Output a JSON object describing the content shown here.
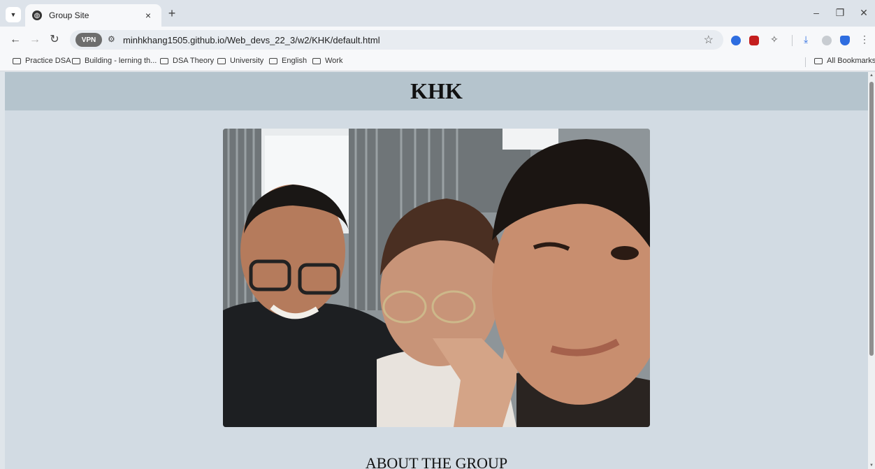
{
  "browser": {
    "tab": {
      "title": "Group Site",
      "close_icon": "×"
    },
    "new_tab_label": "+",
    "url": "minhkhang1505.github.io/Web_devs_22_3/w2/KHK/default.html",
    "vpn_badge": "VPN",
    "window_controls": {
      "minimize": "–",
      "restore": "❐",
      "close": "✕"
    },
    "bookmarks": [
      {
        "label": "Practice DSA"
      },
      {
        "label": "Building - lerning th..."
      },
      {
        "label": "DSA Theory"
      },
      {
        "label": "University"
      },
      {
        "label": "English"
      },
      {
        "label": "Work"
      }
    ],
    "all_bookmarks": "All Bookmarks"
  },
  "page": {
    "header_title": "KHK",
    "section_title": "ABOUT THE GROUP"
  },
  "colors": {
    "header_bg": "#b5c4cd",
    "page_bg": "#d2dbe3"
  }
}
